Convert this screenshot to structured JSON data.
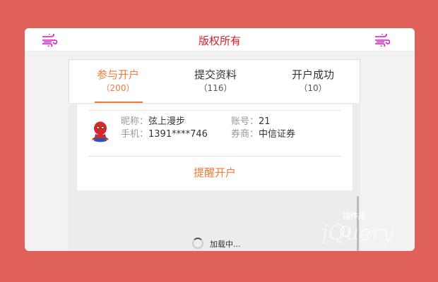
{
  "header": {
    "title": "版权所有",
    "left_icon": "wind-icon",
    "right_icon": "wind-icon",
    "accent_color": "#d11f2a"
  },
  "tabs": [
    {
      "label": "参与开户",
      "count": "（200）",
      "active": true
    },
    {
      "label": "提交资料",
      "count": "（116）",
      "active": false
    },
    {
      "label": "开户成功",
      "count": "（10）",
      "active": false
    }
  ],
  "item": {
    "nickname_label": "昵称：",
    "nickname": "弦上漫步",
    "account_label": "账号：",
    "account": "21",
    "phone_label": "手机：",
    "phone": "1391****746",
    "broker_label": "券商：",
    "broker": "中信证券",
    "action": "提醒开户",
    "avatar_icon": "spiderman-avatar"
  },
  "loading": {
    "text": "加载中..."
  },
  "watermark": {
    "text": "插件库",
    "logo": "jquery-logo"
  },
  "colors": {
    "background": "#e0605a",
    "tab_active": "#f07a3a"
  }
}
